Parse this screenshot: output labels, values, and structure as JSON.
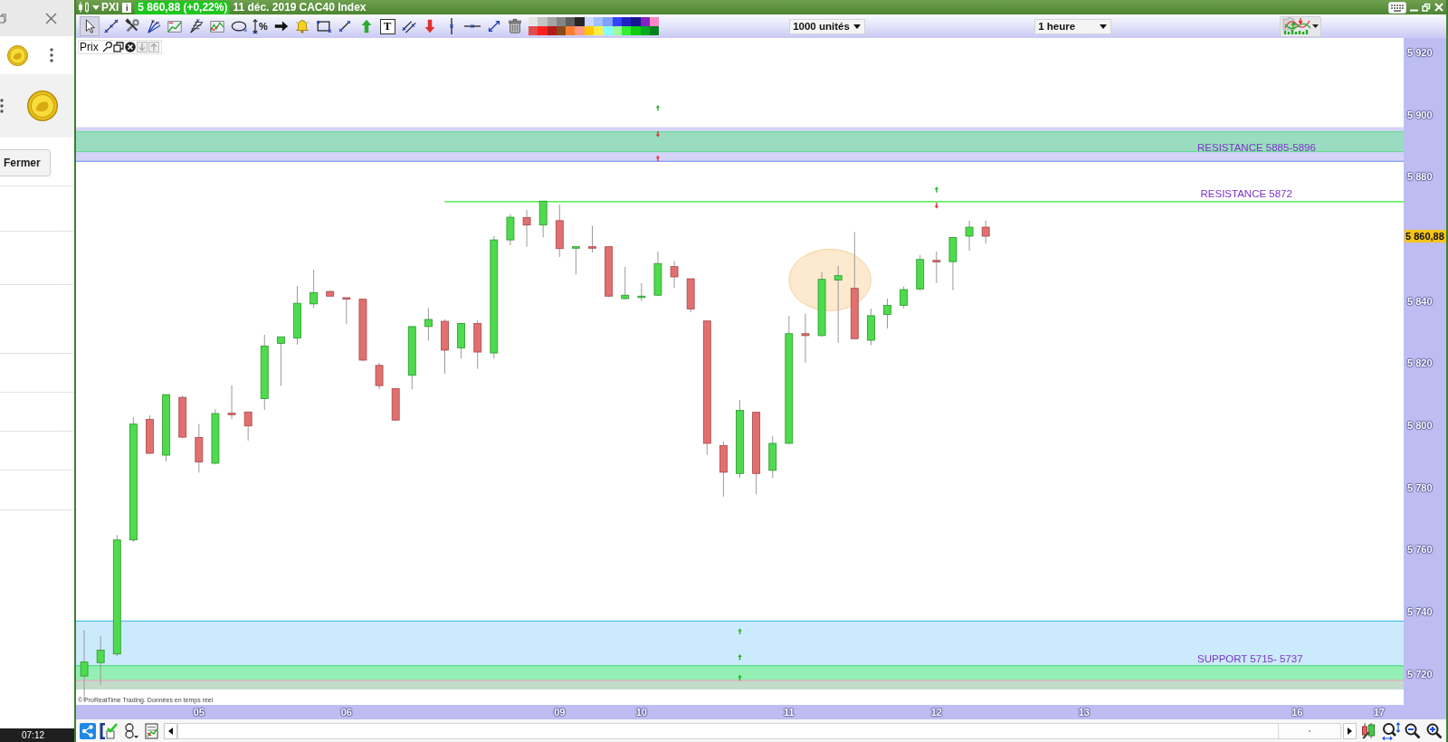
{
  "side_panel": {
    "close_button": "Fermer",
    "clock": "07:12"
  },
  "window": {
    "symbol": "PXI",
    "info": "i",
    "quote": "5 860,88 (+0,22%)",
    "date": "11 déc. 2019",
    "instrument": "CAC40 Index"
  },
  "toolbar": {
    "tools": [
      {
        "kind": "pointer",
        "selected": true
      },
      {
        "kind": "trendline",
        "selected": false
      },
      {
        "kind": "wrench",
        "selected": false
      },
      {
        "kind": "pitchfork",
        "selected": false
      },
      {
        "kind": "channel",
        "selected": false
      },
      {
        "kind": "fan",
        "selected": false
      },
      {
        "kind": "wave",
        "selected": false
      },
      {
        "kind": "ellipse",
        "selected": false
      },
      {
        "kind": "percent",
        "label": "%",
        "selected": false
      },
      {
        "kind": "rightarrow",
        "selected": false
      },
      {
        "kind": "alert",
        "selected": false
      },
      {
        "kind": "rectangle",
        "selected": false
      },
      {
        "kind": "segment",
        "selected": false
      },
      {
        "kind": "uparrow",
        "selected": false
      },
      {
        "kind": "text",
        "label": "T",
        "selected": false
      },
      {
        "kind": "parallel",
        "selected": false
      },
      {
        "kind": "downarrow",
        "selected": false
      },
      {
        "kind": "vline",
        "selected": false
      },
      {
        "kind": "hline",
        "selected": false
      },
      {
        "kind": "diagonal",
        "selected": false
      },
      {
        "kind": "delete",
        "selected": false
      }
    ],
    "palette": [
      {
        "color": "#e4e4e4"
      },
      {
        "color": "#c4c4c4"
      },
      {
        "color": "#a4a4a4"
      },
      {
        "color": "#848484"
      },
      {
        "color": "#5e5e5e"
      },
      {
        "color": "#262626"
      },
      {
        "color": "#c8d8ff"
      },
      {
        "color": "#a0c0ff"
      },
      {
        "color": "#7ea2ff"
      },
      {
        "color": "#3344ff"
      },
      {
        "color": "#2222c4"
      },
      {
        "color": "#151590"
      },
      {
        "color": "#8224c4"
      },
      {
        "color": "#ff84c6"
      },
      {
        "color": "#e04c4c"
      },
      {
        "color": "#ff2020"
      },
      {
        "color": "#b41c1c"
      },
      {
        "color": "#8a4a1a"
      },
      {
        "color": "#ff7f30"
      },
      {
        "color": "#ff9a82"
      },
      {
        "color": "#ffc800"
      },
      {
        "color": "#ffee44"
      },
      {
        "color": "#88ffff"
      },
      {
        "color": "#9cff9c"
      },
      {
        "color": "#33ee33"
      },
      {
        "color": "#11cc11"
      },
      {
        "color": "#00aa22"
      },
      {
        "color": "#008020"
      }
    ],
    "quantity": "1000 unités",
    "timeframe": "1 heure"
  },
  "chart": {
    "series_label": "Prix",
    "copyright": "© ProRealTime Trading. Données en temps réel",
    "chart_data": {
      "type": "candlestick",
      "categories": [
        null,
        null,
        null,
        null,
        null,
        null,
        null,
        "05",
        null,
        null,
        null,
        null,
        null,
        null,
        null,
        null,
        "06",
        null,
        null,
        null,
        null,
        null,
        null,
        null,
        null,
        null,
        null,
        null,
        null,
        "09",
        null,
        null,
        null,
        null,
        "10",
        null,
        null,
        null,
        null,
        null,
        null,
        null,
        null,
        "11",
        null,
        null,
        null,
        null,
        null,
        null,
        null,
        null,
        "12",
        null,
        null,
        null,
        null,
        null,
        null,
        null,
        null,
        "13",
        null,
        null,
        null,
        null,
        null,
        null,
        null,
        null,
        null,
        null,
        null,
        null,
        "16",
        null,
        null,
        null,
        null,
        "17",
        null
      ],
      "ohlc": [
        [
          5719.3,
          5734.1,
          5711.1,
          5723.8
        ],
        [
          5723.6,
          5732.1,
          5716.5,
          5727.6
        ],
        [
          5726.4,
          5764.7,
          5725.7,
          5763.1
        ],
        [
          5763.1,
          5802.6,
          5762.5,
          5800.4
        ],
        [
          5801.9,
          5803.2,
          5790.7,
          5791.0
        ],
        [
          5790.4,
          5809.9,
          5788.4,
          5809.9
        ],
        [
          5809.0,
          5809.6,
          5795.9,
          5796.2
        ],
        [
          5796.1,
          5800.4,
          5784.8,
          5788.2
        ],
        [
          5787.8,
          5805.2,
          5787.4,
          5803.8
        ],
        [
          5803.9,
          5812.9,
          5802.0,
          5803.5
        ],
        [
          5804.3,
          5804.3,
          5795.1,
          5799.8
        ],
        [
          5808.6,
          5829.2,
          5805.0,
          5825.5
        ],
        [
          5826.4,
          5828.5,
          5812.7,
          5828.5
        ],
        [
          5828.1,
          5844.9,
          5826.0,
          5839.3
        ],
        [
          5839.1,
          5850.1,
          5837.8,
          5842.7
        ],
        [
          5843.1,
          5843.4,
          5841.6,
          5841.6
        ],
        [
          5841.1,
          5841.1,
          5832.6,
          5840.6
        ],
        [
          5840.6,
          5840.6,
          5820.6,
          5821.0
        ],
        [
          5819.3,
          5820.1,
          5811.6,
          5812.8
        ],
        [
          5811.8,
          5811.8,
          5801.5,
          5801.7
        ],
        [
          5816.1,
          5831.8,
          5811.6,
          5831.8
        ],
        [
          5831.8,
          5837.8,
          5827.2,
          5834.1
        ],
        [
          5833.5,
          5834.1,
          5816.6,
          5824.2
        ],
        [
          5824.9,
          5832.8,
          5821.5,
          5832.8
        ],
        [
          5832.8,
          5833.8,
          5818.2,
          5823.6
        ],
        [
          5823.3,
          5860.9,
          5821.5,
          5859.7
        ],
        [
          5859.7,
          5868.0,
          5858.0,
          5867.0
        ],
        [
          5866.9,
          5869.3,
          5857.5,
          5864.5
        ],
        [
          5864.5,
          5872.2,
          5860.5,
          5872.2
        ],
        [
          5865.9,
          5871.1,
          5854.2,
          5856.9
        ],
        [
          5857.1,
          5857.5,
          5848.6,
          5857.5
        ],
        [
          5857.5,
          5864.2,
          5855.6,
          5857.2
        ],
        [
          5857.5,
          5857.5,
          5841.3,
          5841.6
        ],
        [
          5840.8,
          5851.0,
          5840.5,
          5841.9
        ],
        [
          5841.3,
          5845.8,
          5840.0,
          5841.6
        ],
        [
          5841.9,
          5856.0,
          5841.6,
          5852.1
        ],
        [
          5851.1,
          5852.9,
          5844.3,
          5847.8
        ],
        [
          5847.2,
          5847.2,
          5836.4,
          5837.5
        ],
        [
          5833.6,
          5833.6,
          5790.5,
          5794.2
        ],
        [
          5793.5,
          5794.8,
          5777.0,
          5784.9
        ],
        [
          5784.5,
          5808.1,
          5783.1,
          5804.8
        ],
        [
          5804.2,
          5804.2,
          5777.8,
          5784.5
        ],
        [
          5785.5,
          5796.6,
          5783.1,
          5794.2
        ],
        [
          5794.2,
          5835.3,
          5793.9,
          5829.5
        ],
        [
          5829.5,
          5835.9,
          5820.1,
          5828.9
        ],
        [
          5828.9,
          5849.4,
          5828.5,
          5847.0
        ],
        [
          5846.8,
          5851.3,
          5826.6,
          5848.2
        ],
        [
          5844.1,
          5862.2,
          5827.9,
          5827.9
        ],
        [
          5827.4,
          5837.6,
          5825.8,
          5835.3
        ],
        [
          5835.7,
          5840.8,
          5831.2,
          5838.6
        ],
        [
          5838.6,
          5844.7,
          5837.7,
          5843.7
        ],
        [
          5843.9,
          5854.8,
          5843.5,
          5853.4
        ],
        [
          5853.1,
          5856.0,
          5845.8,
          5852.7
        ],
        [
          5852.7,
          5860.5,
          5843.5,
          5860.5
        ],
        [
          5860.9,
          5865.9,
          5856.2,
          5863.8
        ],
        [
          5863.8,
          5865.9,
          5858.5,
          5860.9
        ],
        null,
        null,
        null,
        null,
        null,
        null,
        null,
        null,
        null,
        null,
        null,
        null,
        null,
        null,
        null,
        null,
        null,
        null,
        null,
        null,
        null,
        null,
        null,
        null,
        null
      ],
      "ylim": [
        5710,
        5924.7
      ],
      "yticks": [
        {
          "value": 5920,
          "label": "5 920"
        },
        {
          "value": 5900,
          "label": "5 900"
        },
        {
          "value": 5880,
          "label": "5 880"
        },
        {
          "value": 5840,
          "label": "5 840"
        },
        {
          "value": 5820,
          "label": "5 820"
        },
        {
          "value": 5800,
          "label": "5 800"
        },
        {
          "value": 5780,
          "label": "5 780"
        },
        {
          "value": 5760,
          "label": "5 760"
        },
        {
          "value": 5740,
          "label": "5 740"
        },
        {
          "value": 5720,
          "label": "5 720"
        }
      ],
      "bands": [
        {
          "axis": "y",
          "from": 5885,
          "to": 5896,
          "color": "#d4d4f8",
          "label": "RESISTANCE 5885-5896"
        },
        {
          "axis": "y",
          "from": 5888.1,
          "to": 5894.5,
          "color": "#9adcc0"
        },
        {
          "axis": "y",
          "from": 5715,
          "to": 5737,
          "color": "#cbeafb",
          "label": "SUPPORT 5715- 5737"
        },
        {
          "axis": "y",
          "from": 5717.9,
          "to": 5722.6,
          "color": "#94efb4"
        },
        {
          "axis": "y",
          "from": 5715,
          "to": 5717.9,
          "color": "#c2dcc8"
        }
      ],
      "ref_lines": [
        {
          "axis": "y",
          "value": 5872,
          "color": "#2ee62e",
          "label": "RESISTANCE 5872"
        },
        {
          "axis": "y",
          "value": 5885,
          "color": "#6a8cf0"
        },
        {
          "axis": "y",
          "value": 5737,
          "color": "#2fb6ee"
        },
        {
          "axis": "y",
          "value": 5894.5,
          "color": "#5edc84"
        },
        {
          "axis": "y",
          "value": 5888.1,
          "color": "#5edc84"
        },
        {
          "axis": "y",
          "value": 5722.6,
          "color": "#3fd86a"
        },
        {
          "axis": "y",
          "value": 5717.9,
          "color": "#f0a0c0"
        }
      ]
    }
  },
  "price_axis": {
    "current_price": "5 860,88"
  }
}
